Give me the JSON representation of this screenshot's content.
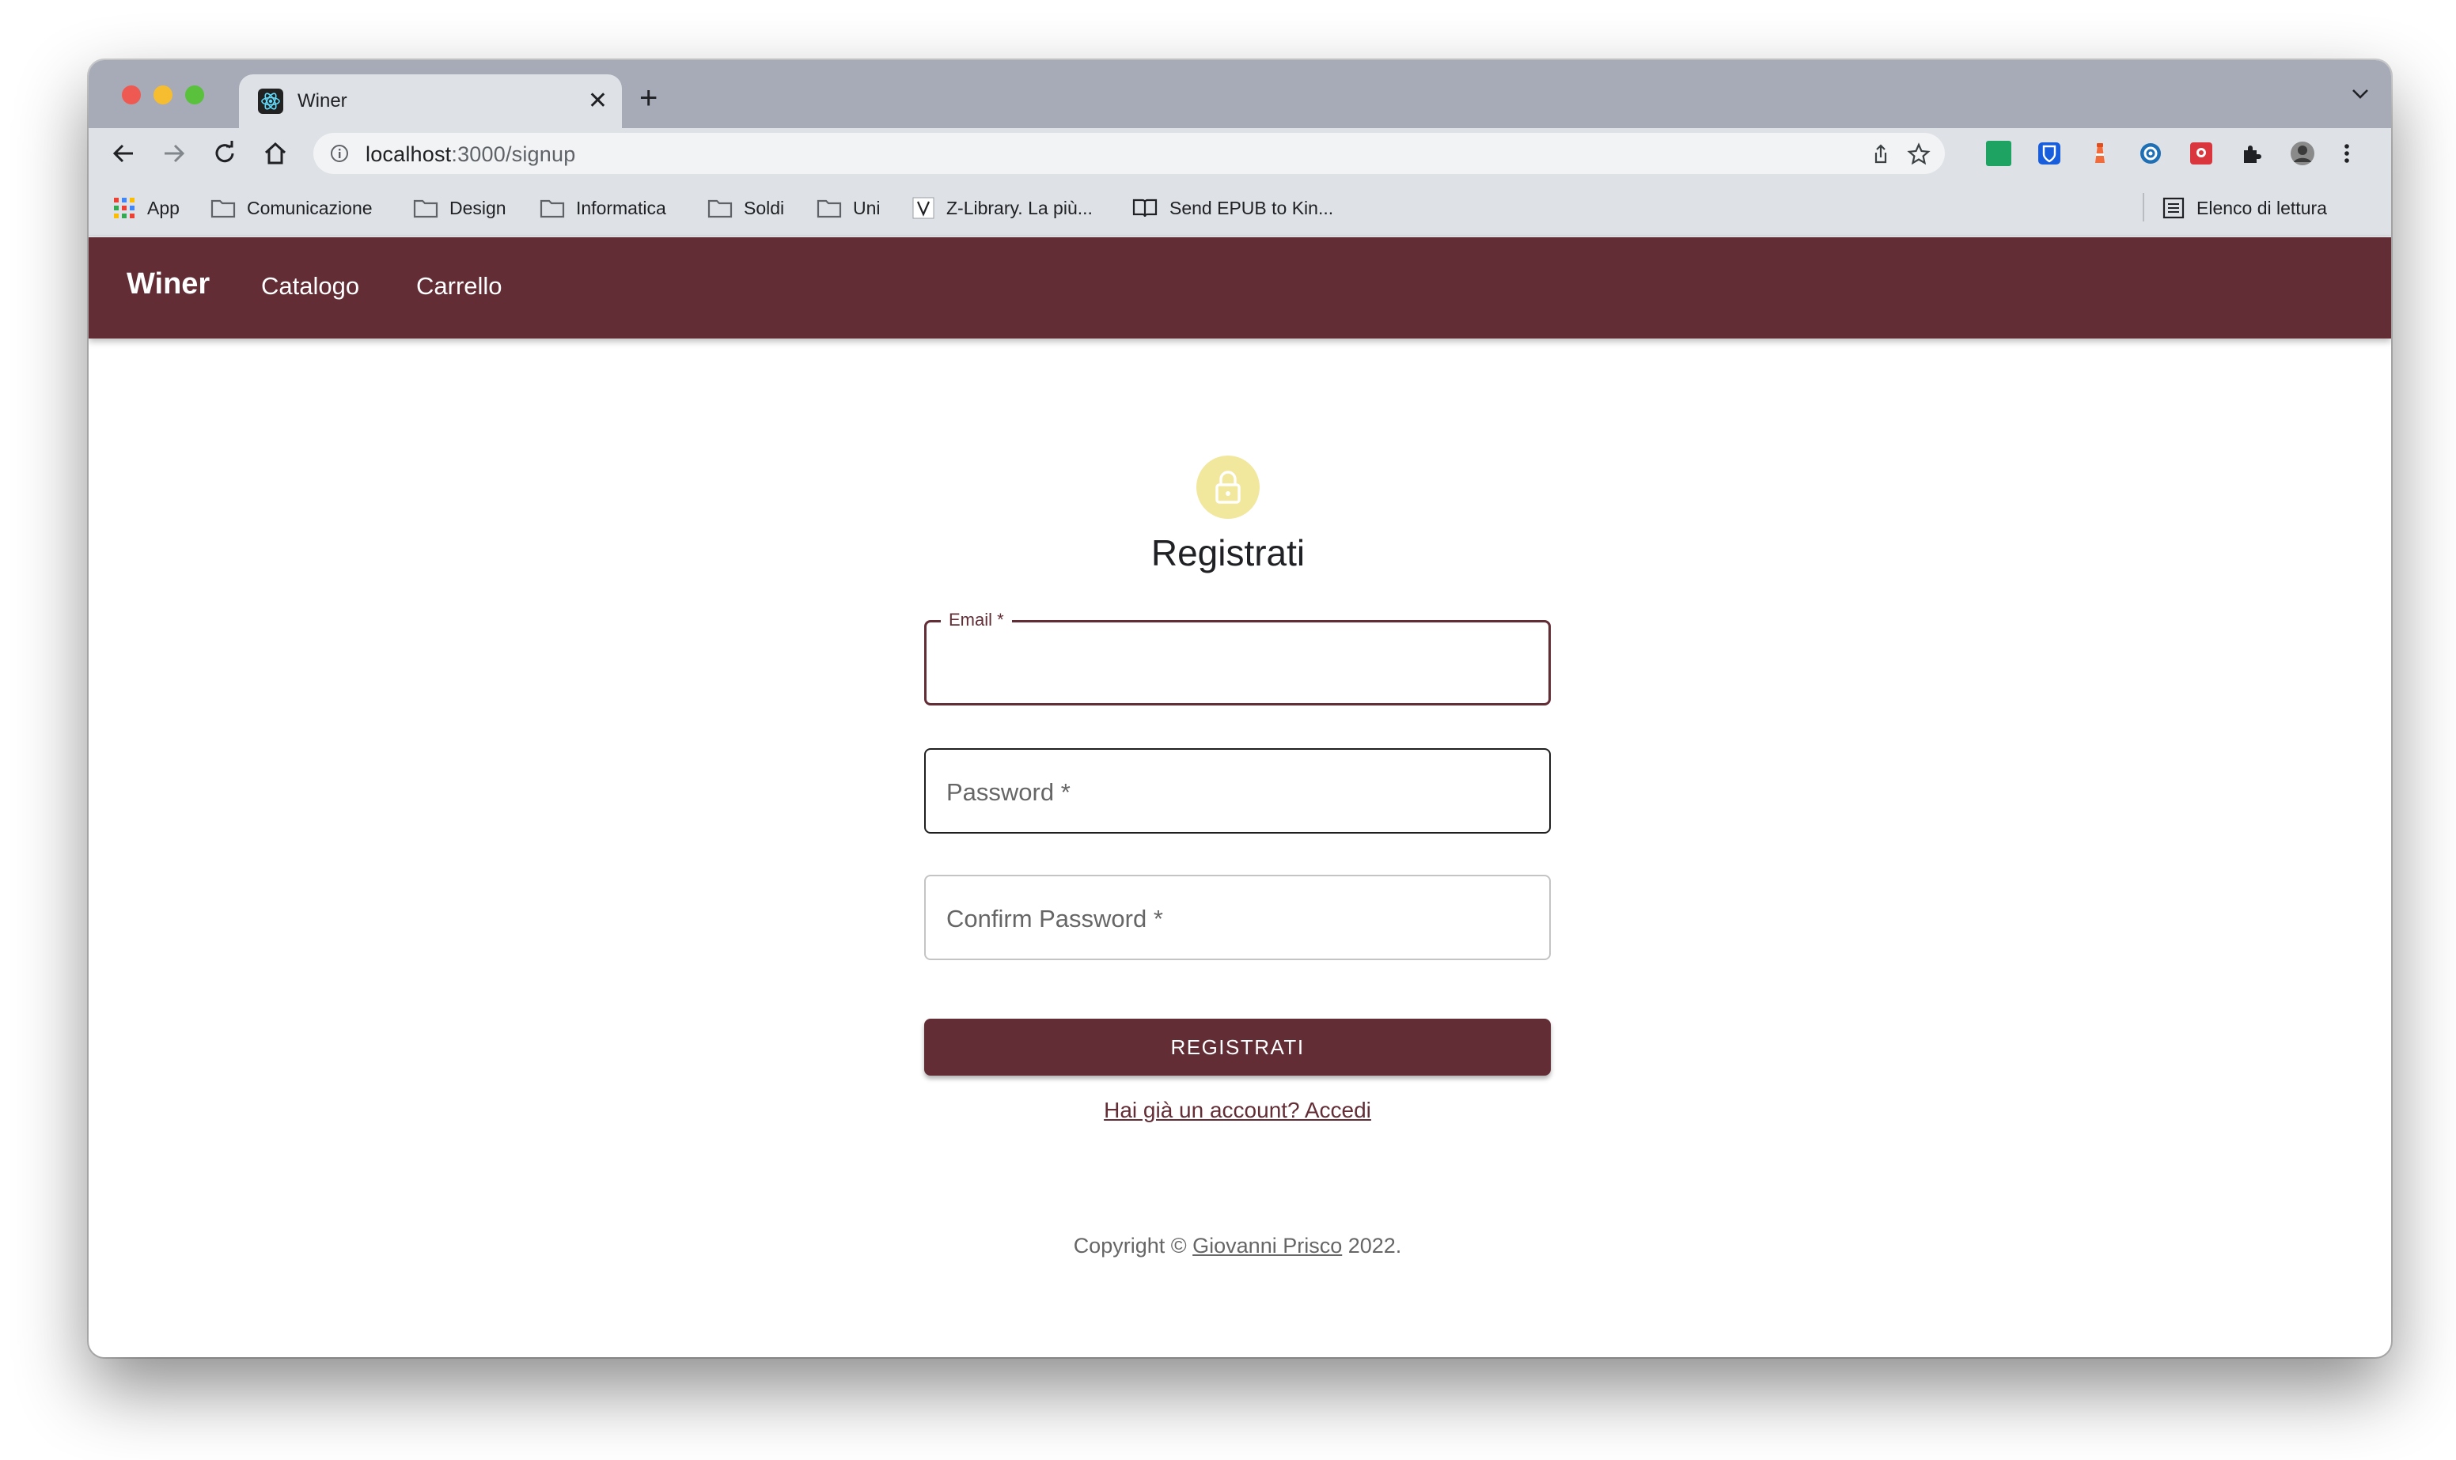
{
  "browser": {
    "tab_title": "Winer",
    "url_host": "localhost",
    "url_path": ":3000/signup",
    "bookmarks": [
      "App",
      "Comunicazione",
      "Design",
      "Informatica",
      "Soldi",
      "Uni",
      "Z-Library. La più...",
      "Send EPUB to Kin..."
    ],
    "reading_list": "Elenco di lettura"
  },
  "app": {
    "brand": "Winer",
    "nav": [
      "Catalogo",
      "Carrello"
    ],
    "title": "Registrati",
    "fields": {
      "email_label": "Email *",
      "password_label": "Password *",
      "confirm_label": "Confirm Password *"
    },
    "submit_label": "REGISTRATI",
    "login_link": "Hai già un account? Accedi",
    "copyright_prefix": "Copyright © ",
    "copyright_author": "Giovanni Prisco",
    "copyright_suffix": " 2022."
  },
  "colors": {
    "primary": "#632d36",
    "avatar_bg": "#f1e79d",
    "chrome": "#dee1e6",
    "tabstrip": "#a7abb7"
  }
}
